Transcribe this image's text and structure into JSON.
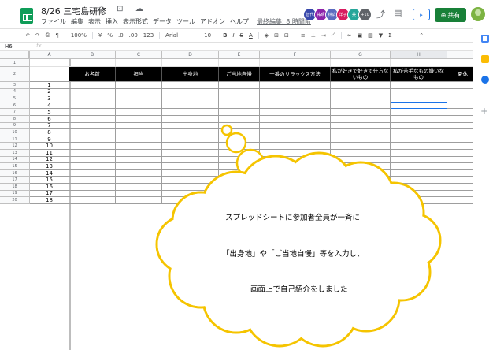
{
  "app": {
    "doc_title": "8/26 三宅島研修",
    "title_icons": "☆ ⊡ ☁",
    "menu": [
      "ファイル",
      "編集",
      "表示",
      "挿入",
      "表示形式",
      "データ",
      "ツール",
      "アドオン",
      "ヘルプ"
    ],
    "last_edit": "最終編集: 8 時間前",
    "collaborators": [
      {
        "label": "智代",
        "color": "#3949ab"
      },
      {
        "label": "祐晴",
        "color": "#8e24aa"
      },
      {
        "label": "林広",
        "color": "#5c6bc0"
      },
      {
        "label": "洋子",
        "color": "#d81b60"
      },
      {
        "label": "美",
        "color": "#26a69a"
      }
    ],
    "collaborator_more": "+10",
    "share_label": "共有",
    "accent_green": "#188038"
  },
  "toolbar": {
    "undo_icon": "↶",
    "redo_icon": "↷",
    "print_icon": "⎙",
    "paint_icon": "¶",
    "zoom": "100%",
    "currency": "¥",
    "percent": "%",
    "dec_less": ".0",
    "dec_more": ".00",
    "format_123": "123",
    "font": "Arial",
    "font_size": "10",
    "bold": "B",
    "italic": "I",
    "strike": "S",
    "text_color": "A",
    "more": "···"
  },
  "formula": {
    "cell_ref": "H6",
    "fx": "fx"
  },
  "grid": {
    "columns": [
      "A",
      "B",
      "C",
      "D",
      "E",
      "F",
      "G",
      "H"
    ],
    "header_labels": [
      "",
      "お名前",
      "担当",
      "出身地",
      "ご当地自慢",
      "一番のリラックス方法",
      "私が好きで好きで仕方ないもの",
      "私が苦手なもの嫌いなもの",
      "夏休"
    ],
    "row_numbers": [
      "1",
      "2",
      "3",
      "4",
      "5",
      "6",
      "7",
      "8",
      "9",
      "10",
      "11",
      "12",
      "13",
      "14",
      "15",
      "16",
      "17",
      "18",
      "19",
      "20"
    ],
    "a_values": [
      "1",
      "2",
      "3",
      "4",
      "5",
      "6",
      "7",
      "8",
      "9",
      "10",
      "11",
      "12",
      "13",
      "14",
      "15",
      "16",
      "17",
      "18"
    ],
    "selected_cell": "H6"
  },
  "callout": {
    "line1": "スプレッドシートに参加者全員が一斉に",
    "line2": "「出身地」や「ご当地自慢」等を入力し、",
    "line3": "画面上で自己紹介をしました",
    "fill": "#ffffff",
    "stroke": "#f5c400"
  }
}
